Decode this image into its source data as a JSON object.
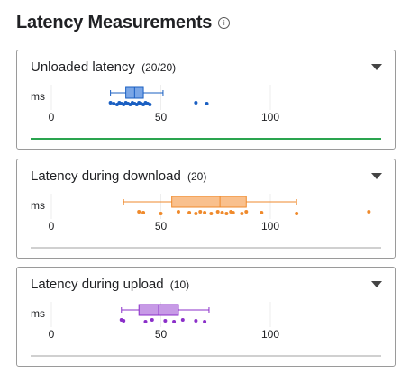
{
  "page": {
    "title": "Latency Measurements",
    "info_icon": "info-icon"
  },
  "cards": [
    {
      "label": "Unloaded latency",
      "count": "(20/20)",
      "unit": "ms",
      "ticks": [
        "0",
        "50",
        "100"
      ],
      "color": "#1a5fc2",
      "box_fill": "#7aa6e6",
      "line_color": "#2aa44f",
      "stats": {
        "min": 27,
        "q1": 34,
        "median": 38,
        "q3": 42,
        "max": 51
      },
      "points": [
        27,
        28.5,
        30,
        31,
        32,
        33,
        34,
        35,
        36,
        37,
        38,
        39,
        40,
        41,
        42,
        43,
        44,
        45,
        66,
        71
      ]
    },
    {
      "label": "Latency during download",
      "count": "(20)",
      "unit": "ms",
      "ticks": [
        "0",
        "50",
        "100"
      ],
      "color": "#ef8a2c",
      "box_fill": "#f9c08d",
      "line_color": "#d0d0d0",
      "stats": {
        "min": 33,
        "q1": 55,
        "median": 77,
        "q3": 89,
        "max": 112
      },
      "points": [
        40,
        42,
        50,
        58,
        63,
        66,
        68,
        70,
        73,
        76,
        78,
        80,
        82,
        83,
        87,
        89,
        96,
        112,
        145
      ]
    },
    {
      "label": "Latency during upload",
      "count": "(10)",
      "unit": "ms",
      "ticks": [
        "0",
        "50",
        "100"
      ],
      "color": "#8b2fc9",
      "box_fill": "#c79ae6",
      "line_color": "#d0d0d0",
      "stats": {
        "min": 32,
        "q1": 40,
        "median": 49,
        "q3": 58,
        "max": 72
      },
      "points": [
        32,
        33,
        43,
        46,
        52,
        56,
        60,
        66,
        70
      ]
    }
  ],
  "chart_data": [
    {
      "type": "boxplot",
      "title": "Unloaded latency",
      "xlabel": "ms",
      "xlim": [
        0,
        150
      ],
      "stats": {
        "min": 27,
        "q1": 34,
        "median": 38,
        "q3": 42,
        "max": 51
      }
    },
    {
      "type": "boxplot",
      "title": "Latency during download",
      "xlabel": "ms",
      "xlim": [
        0,
        150
      ],
      "stats": {
        "min": 33,
        "q1": 55,
        "median": 77,
        "q3": 89,
        "max": 112
      }
    },
    {
      "type": "boxplot",
      "title": "Latency during upload",
      "xlabel": "ms",
      "xlim": [
        0,
        150
      ],
      "stats": {
        "min": 32,
        "q1": 40,
        "median": 49,
        "q3": 58,
        "max": 72
      }
    }
  ]
}
